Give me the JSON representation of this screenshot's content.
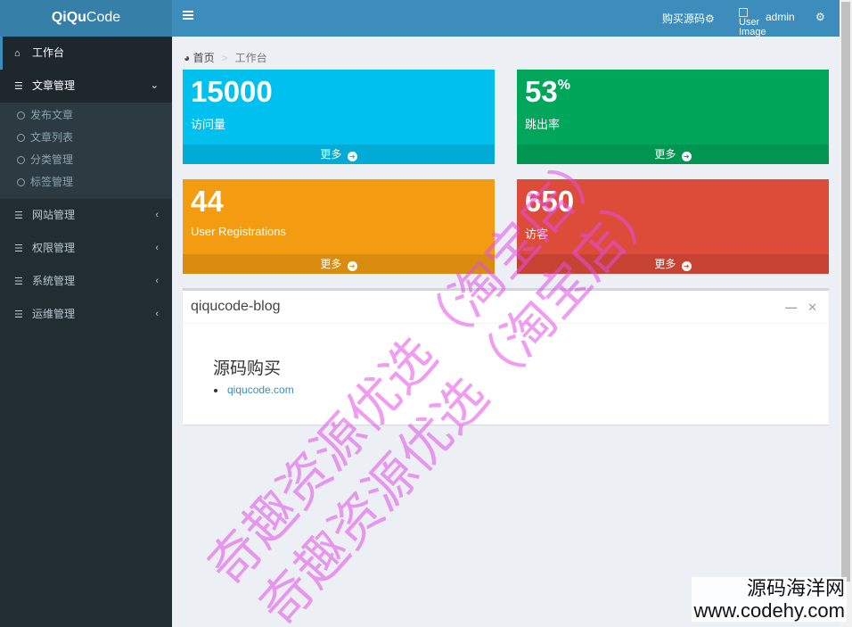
{
  "brand": {
    "bold": "QiQu",
    "rest": "Code"
  },
  "header": {
    "buy_label": "购买源码",
    "avatar_alt": "User Image",
    "username": "admin"
  },
  "sidebar": {
    "active": "工作台",
    "menus": [
      {
        "label": "文章管理",
        "expanded": true,
        "children": [
          "发布文章",
          "文章列表",
          "分类管理",
          "标签管理"
        ]
      },
      {
        "label": "网站管理"
      },
      {
        "label": "权限管理"
      },
      {
        "label": "系统管理"
      },
      {
        "label": "运维管理"
      }
    ]
  },
  "breadcrumb": {
    "home": "首页",
    "current": "工作台"
  },
  "stats": [
    {
      "value": "15000",
      "suffix": "",
      "label": "访问量",
      "more": "更多",
      "color": "#00c0ef"
    },
    {
      "value": "53",
      "suffix": "%",
      "label": "跳出率",
      "more": "更多",
      "color": "#00a65a"
    },
    {
      "value": "44",
      "suffix": "",
      "label": "User Registrations",
      "more": "更多",
      "color": "#f39c12"
    },
    {
      "value": "650",
      "suffix": "",
      "label": "访客",
      "more": "更多",
      "color": "#dd4b39"
    }
  ],
  "panel": {
    "title": "qiqucode-blog",
    "heading": "源码购买",
    "link": "qiqucode.com"
  },
  "watermark": {
    "line1": "奇趣资源优选（淘宝店）",
    "line2": "奇趣资源优选（淘宝店）",
    "site_name": "源码海洋网",
    "site_url": "www.codehy.com"
  },
  "colors": {
    "header": "#3c8dbc",
    "logo_bg": "#367fa9",
    "sidebar": "#222d32"
  }
}
